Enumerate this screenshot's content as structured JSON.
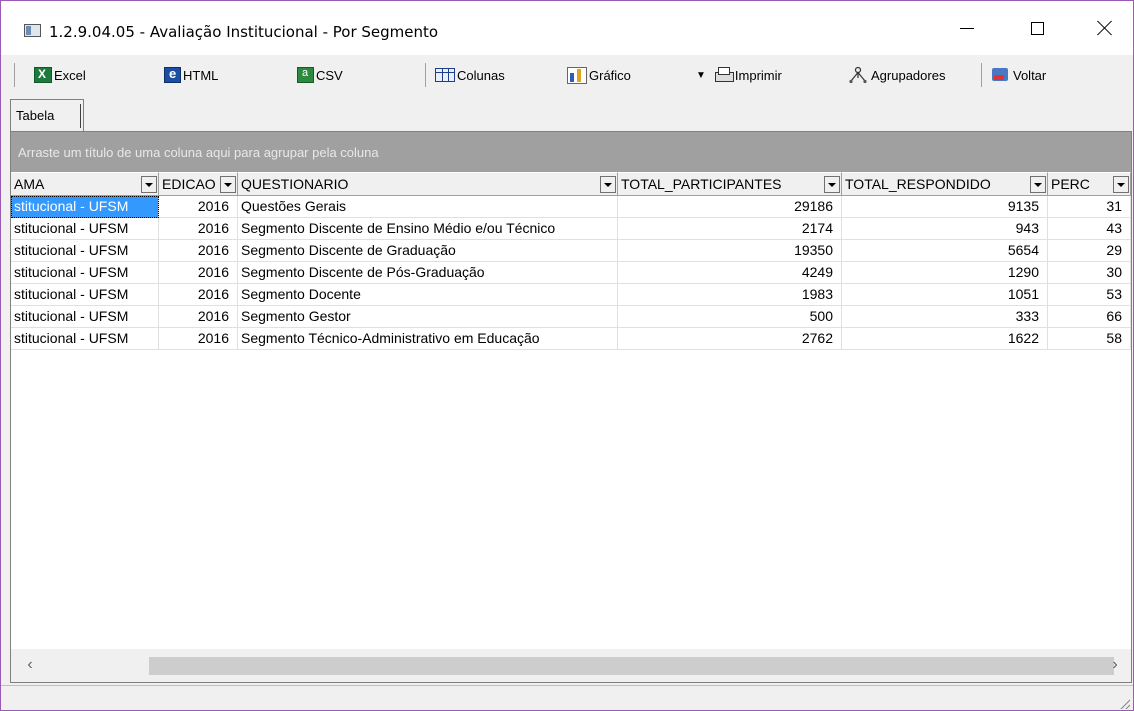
{
  "window": {
    "title": "1.2.9.04.05 - Avaliação Institucional - Por Segmento"
  },
  "toolbar": {
    "excel": "Excel",
    "html": "HTML",
    "csv": "CSV",
    "colunas": "Colunas",
    "grafico": "Gráfico",
    "imprimir": "Imprimir",
    "agrupadores": "Agrupadores",
    "voltar": "Voltar"
  },
  "tabs": [
    {
      "label": "Tabela"
    }
  ],
  "grid": {
    "group_hint": "Arraste um título de uma coluna aqui para agrupar pela coluna",
    "columns": [
      "AMA",
      "EDICAO",
      "QUESTIONARIO",
      "TOTAL_PARTICIPANTES",
      "TOTAL_RESPONDIDO",
      "PERC"
    ],
    "rows": [
      [
        "stitucional - UFSM",
        "2016",
        "Questões Gerais",
        "29186",
        "9135",
        "31"
      ],
      [
        "stitucional - UFSM",
        "2016",
        "Segmento Discente de Ensino Médio e/ou Técnico",
        "2174",
        "943",
        "43"
      ],
      [
        "stitucional - UFSM",
        "2016",
        "Segmento Discente de Graduação",
        "19350",
        "5654",
        "29"
      ],
      [
        "stitucional - UFSM",
        "2016",
        "Segmento Discente de Pós-Graduação",
        "4249",
        "1290",
        "30"
      ],
      [
        "stitucional - UFSM",
        "2016",
        "Segmento Docente",
        "1983",
        "1051",
        "53"
      ],
      [
        "stitucional - UFSM",
        "2016",
        "Segmento Gestor",
        "500",
        "333",
        "66"
      ],
      [
        "stitucional - UFSM",
        "2016",
        "Segmento Técnico-Administrativo em Educação",
        "2762",
        "1622",
        "58"
      ]
    ]
  },
  "icons": {
    "excel": "excel-icon",
    "html": "html-icon",
    "csv": "csv-icon",
    "colunas": "columns-icon",
    "grafico": "chart-icon",
    "imprimir": "printer-icon",
    "agrupadores": "group-icon",
    "voltar": "back-icon"
  }
}
